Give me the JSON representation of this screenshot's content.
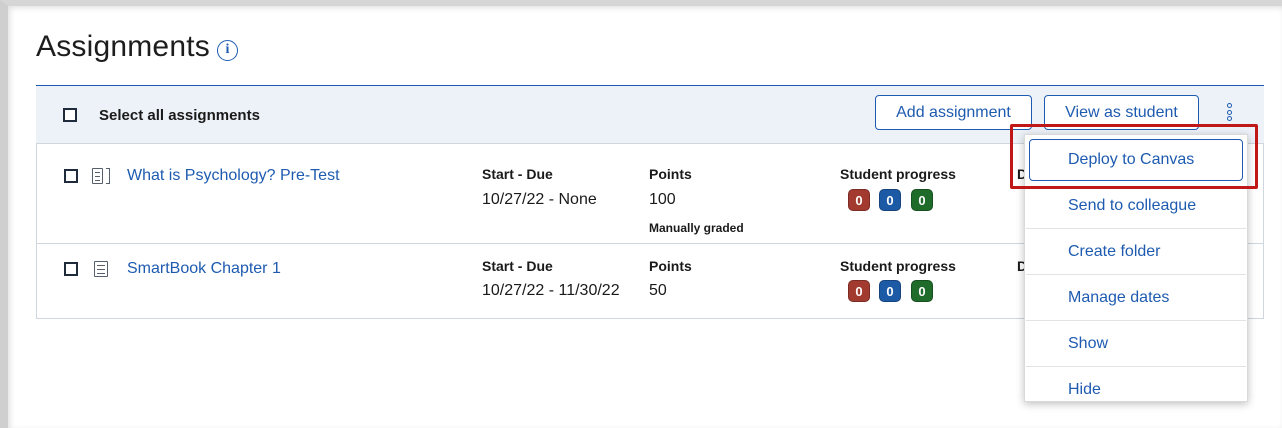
{
  "header": {
    "title": "Assignments",
    "info_icon": "info-icon"
  },
  "toolbar": {
    "select_all_label": "Select all assignments",
    "add_assignment_label": "Add assignment",
    "view_as_student_label": "View as student",
    "more_icon": "kebab-vertical-icon"
  },
  "columns": {
    "start_due": "Start - Due",
    "points": "Points",
    "student_progress": "Student progress"
  },
  "assignments": [
    {
      "title": "What is Psychology? Pre-Test",
      "icon": "test-document-icon",
      "start_due": "10/27/22 - None",
      "points": "100",
      "points_note": "Manually graded",
      "progress": [
        "0",
        "0",
        "0"
      ],
      "truncated_col": "D"
    },
    {
      "title": "SmartBook Chapter 1",
      "icon": "document-icon",
      "start_due": "10/27/22 - 11/30/22",
      "points": "50",
      "progress": [
        "0",
        "0",
        "0"
      ],
      "truncated_col": "D"
    }
  ],
  "menu": {
    "items": [
      "Deploy to Canvas",
      "Send to colleague",
      "Create folder",
      "Manage dates",
      "Show",
      "Hide"
    ],
    "active_index": 0
  },
  "colors": {
    "accent": "#1e5bb0",
    "highlight": "#c01717",
    "progress_red": "#a33a2f",
    "progress_blue": "#1d5aa6",
    "progress_green": "#1f6b2a"
  }
}
